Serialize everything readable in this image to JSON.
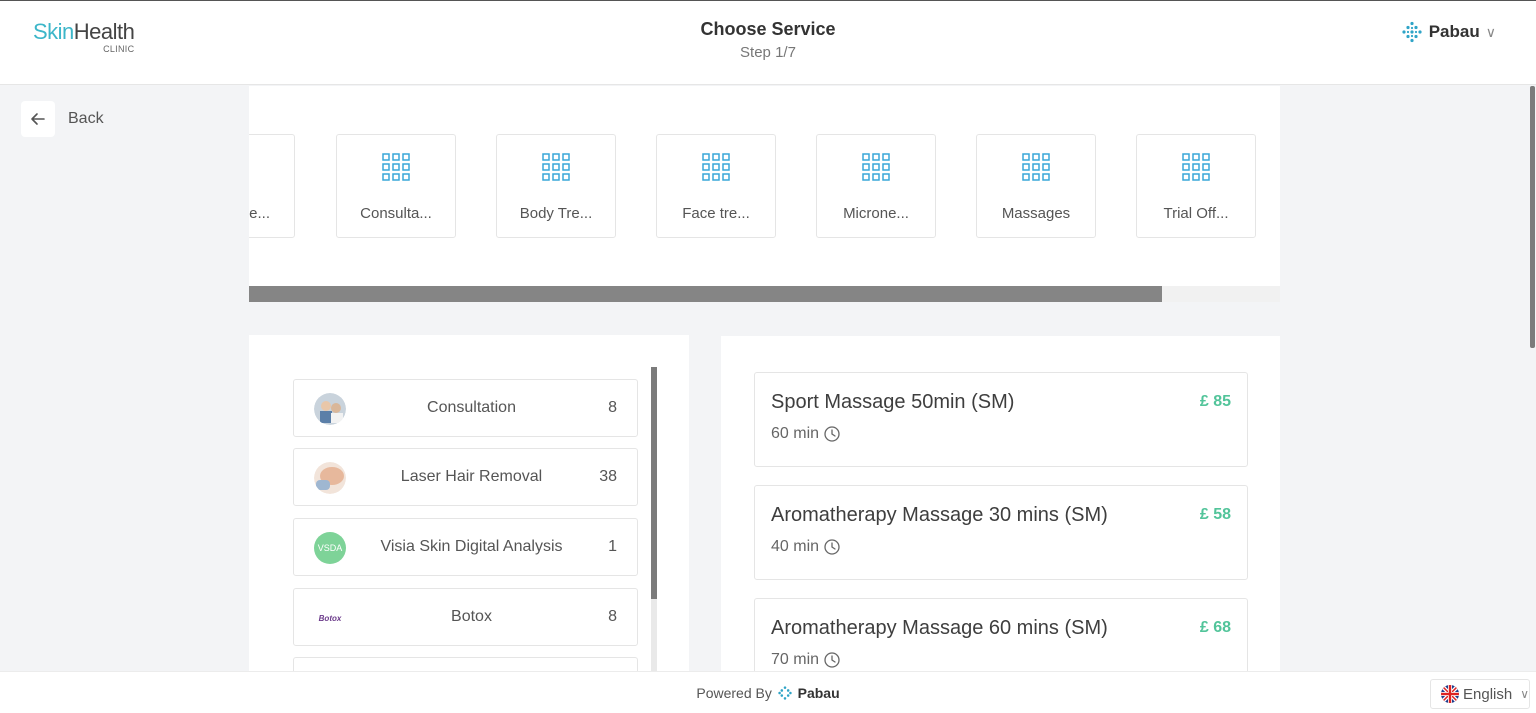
{
  "header": {
    "logo_main_a": "Skin",
    "logo_main_b": "Health",
    "logo_sub": "CLINIC",
    "title": "Choose Service",
    "step": "Step 1/7",
    "brand_name": "Pabau",
    "brand_chevron": "∨"
  },
  "back": {
    "label": "Back",
    "icon": "arrow-left-icon"
  },
  "categories": [
    {
      "label": "re..."
    },
    {
      "label": "Consulta..."
    },
    {
      "label": "Body Tre..."
    },
    {
      "label": "Face tre..."
    },
    {
      "label": "Microne..."
    },
    {
      "label": "Massages"
    },
    {
      "label": "Trial Off..."
    }
  ],
  "services": [
    {
      "name": "Consultation",
      "count": "8"
    },
    {
      "name": "Laser Hair Removal",
      "count": "38"
    },
    {
      "name": "Visia Skin Digital Analysis",
      "count": "1",
      "avatar_text": "VSDA"
    },
    {
      "name": "Botox",
      "count": "8",
      "avatar_text": "Botox"
    }
  ],
  "items": [
    {
      "name": "Sport Massage 50min (SM)",
      "duration": "60 min",
      "price": "£ 85"
    },
    {
      "name": "Aromatherapy Massage 30 mins (SM)",
      "duration": "40 min",
      "price": "£ 58"
    },
    {
      "name": "Aromatherapy Massage 60 mins (SM)",
      "duration": "70 min",
      "price": "£ 68"
    }
  ],
  "footer": {
    "powered_by": "Powered By",
    "brand": "Pabau",
    "language": "English",
    "lang_chevron": "∨"
  },
  "colors": {
    "accent": "#3cb6c9",
    "price": "#52c49a",
    "brand_icon": "#2fa4c7"
  }
}
